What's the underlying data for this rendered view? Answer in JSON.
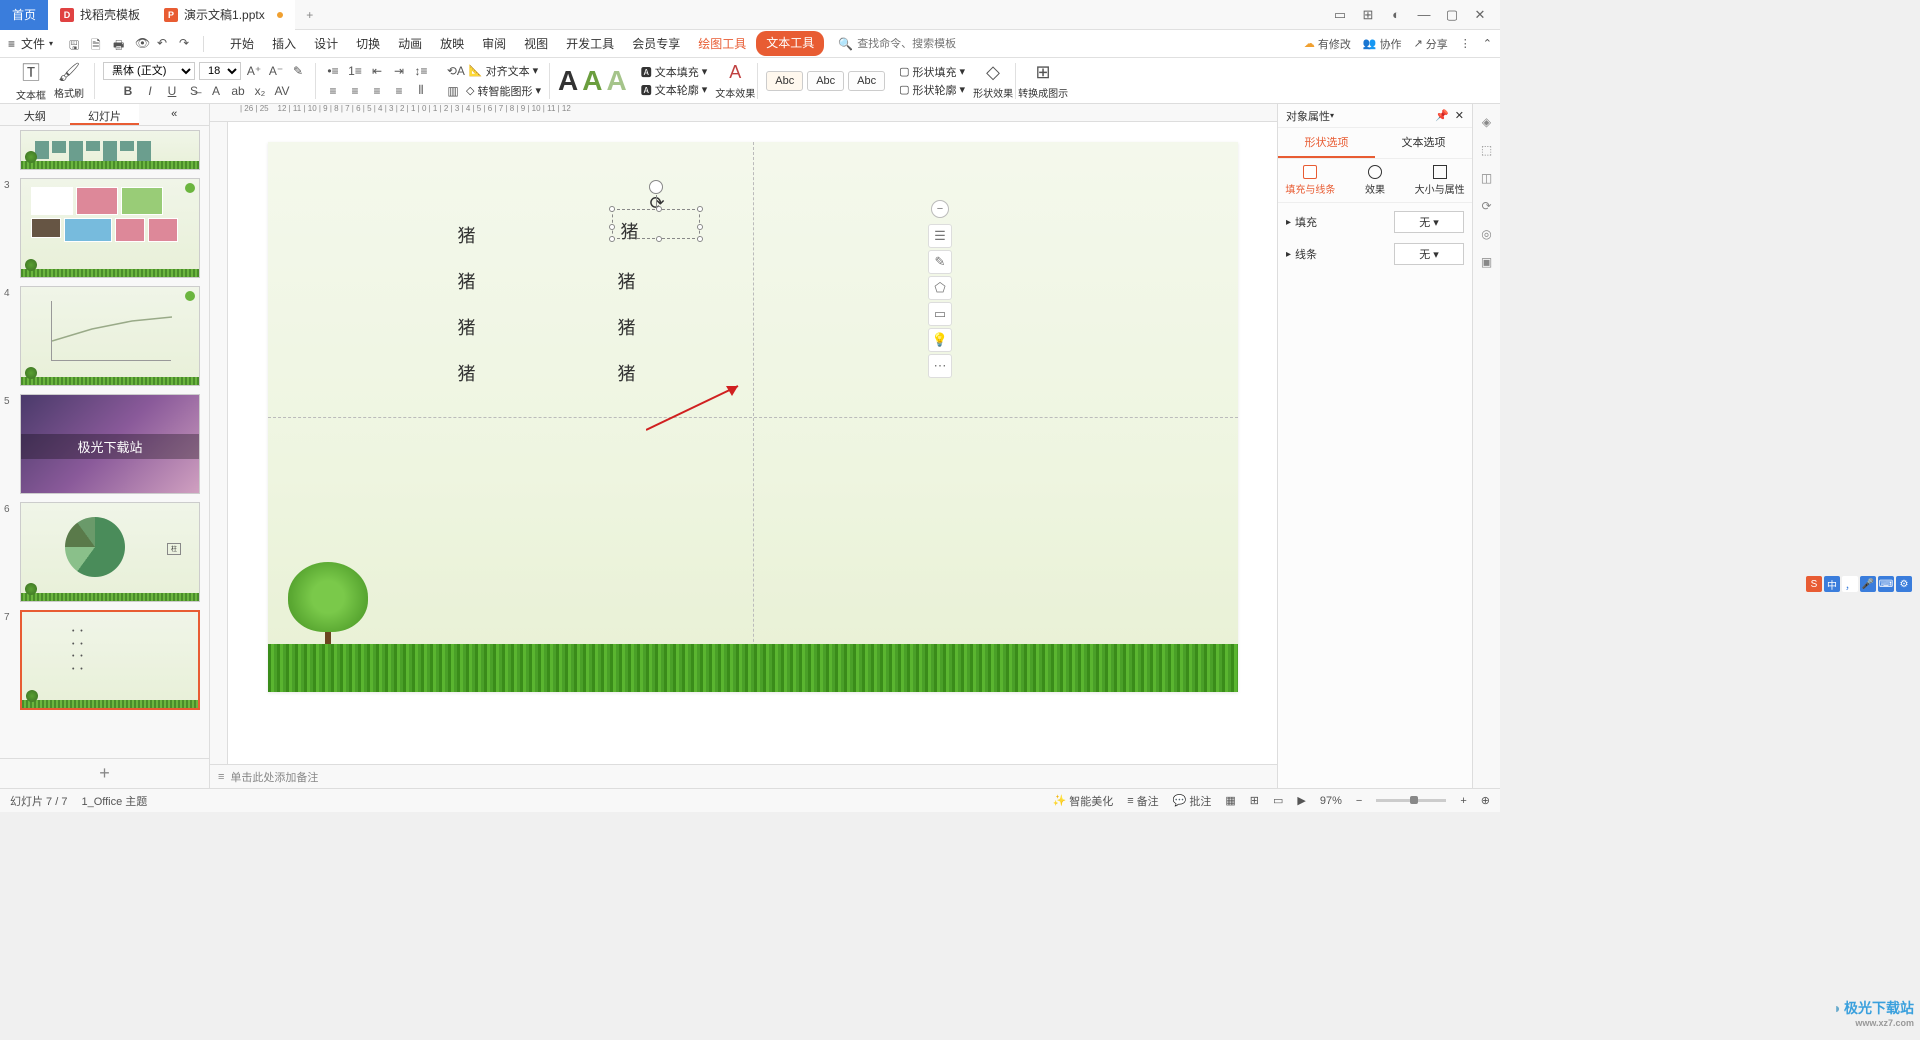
{
  "titlebar": {
    "home": "首页",
    "app_tab": "找稻壳模板",
    "doc_tab": "演示文稿1.pptx"
  },
  "menubar": {
    "file": "文件",
    "tabs": [
      "开始",
      "插入",
      "设计",
      "切换",
      "动画",
      "放映",
      "审阅",
      "视图",
      "开发工具",
      "会员专享"
    ],
    "draw_tool": "绘图工具",
    "text_tool": "文本工具",
    "search_ph": "查找命令、搜索模板",
    "pending": "有修改",
    "coop": "协作",
    "share": "分享"
  },
  "ribbon": {
    "textbox": "文本框",
    "brush": "格式刷",
    "font_name": "黑体 (正文)",
    "font_size": "18",
    "align_text": "对齐文本",
    "smart_shape": "转智能图形",
    "text_fill": "文本填充",
    "text_outline": "文本轮廓",
    "text_effect": "文本效果",
    "abc": "Abc",
    "shape_fill": "形状填充",
    "shape_outline": "形状轮廓",
    "shape_effect": "形状效果",
    "to_diagram": "转换成图示"
  },
  "leftpanel": {
    "tab_outline": "大纲",
    "tab_slides": "幻灯片",
    "fantasy_title": "极光下载站"
  },
  "slide": {
    "char": "猪"
  },
  "rightpanel": {
    "title": "对象属性",
    "tab_shape": "形状选项",
    "tab_text": "文本选项",
    "sub_fill": "填充与线条",
    "sub_effect": "效果",
    "sub_size": "大小与属性",
    "fill_label": "填充",
    "line_label": "线条",
    "none": "无"
  },
  "notes": {
    "placeholder": "单击此处添加备注"
  },
  "status": {
    "slide_info": "幻灯片 7 / 7",
    "theme": "1_Office 主题",
    "beautify": "智能美化",
    "notes": "备注",
    "comments": "批注",
    "zoom": "97%"
  },
  "watermark": {
    "text": "极光下载站",
    "url": "www.xz7.com"
  }
}
